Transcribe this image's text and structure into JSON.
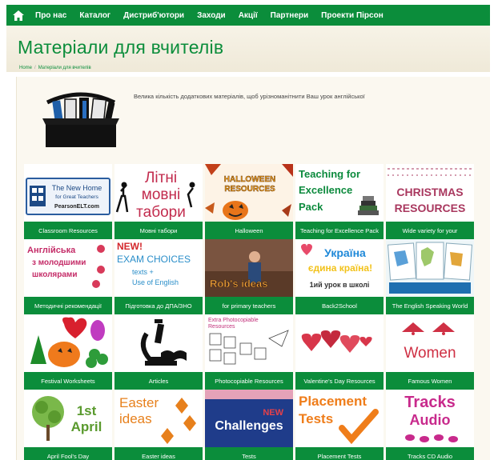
{
  "nav": {
    "home_icon": "home-icon",
    "items": [
      "Про нас",
      "Каталог",
      "Дистриб'ютори",
      "Заходи",
      "Акції",
      "Партнери",
      "Проекти Пірсон"
    ]
  },
  "header": {
    "title": "Матеріали для вчителів",
    "breadcrumb": [
      "Home",
      "Матеріали для вчителів"
    ]
  },
  "intro": {
    "icon": "toolbox-icon",
    "text": "Велика кількість додаткових матеріалів, щоб урізноманітнити Ваш урок англійської"
  },
  "colors": {
    "primary_green": "#0b8d3b",
    "header_bg": "#f3efe2"
  },
  "tiles": [
    {
      "caption": "Classroom Resources",
      "image_text": [
        "The New Home",
        "for Great Teachers",
        "PearsonELT.com"
      ]
    },
    {
      "caption": "Мовні табори",
      "image_text": [
        "Літні",
        "мовні",
        "табори"
      ]
    },
    {
      "caption": "Halloween",
      "image_text": [
        "HALLOWEEN",
        "RESOURCES"
      ]
    },
    {
      "caption": "Teaching for Excellence Pack",
      "image_text": [
        "Teaching for",
        "Excellence",
        "Pack"
      ]
    },
    {
      "caption": "Wide variety for your",
      "image_text": [
        "CHRISTMAS",
        "RESOURCES"
      ]
    },
    {
      "caption": "Методичні рекомендації",
      "image_text": [
        "Англійська",
        "з молодшими",
        "школярами"
      ]
    },
    {
      "caption": "Підготовка до ДПА/ЗНО",
      "image_text": [
        "NEW!",
        "EXAM CHOICES",
        "texts +",
        "Use of English"
      ]
    },
    {
      "caption": "for primary teachers",
      "image_text": [
        "Rob's ideas"
      ]
    },
    {
      "caption": "Back2School",
      "image_text": [
        "Україна",
        "єдина країна!",
        "1ий урок в школі"
      ]
    },
    {
      "caption": "The English Speaking World",
      "image_text": []
    },
    {
      "caption": "Festival Worksheets",
      "image_text": []
    },
    {
      "caption": "Articles",
      "image_text": []
    },
    {
      "caption": "Photocopiable Resources",
      "image_text": [
        "Extra Photocopiable",
        "Resources"
      ]
    },
    {
      "caption": "Valentine's Day Resources",
      "image_text": []
    },
    {
      "caption": "Famous Women",
      "image_text": [
        "Women"
      ]
    },
    {
      "caption": "April Fool's Day",
      "image_text": [
        "1st",
        "April"
      ]
    },
    {
      "caption": "Easter ideas",
      "image_text": [
        "Easter",
        "ideas"
      ]
    },
    {
      "caption": "Tests",
      "image_text": [
        "NEW",
        "Challenges"
      ]
    },
    {
      "caption": "Placement Tests",
      "image_text": [
        "Placement",
        "Tests"
      ]
    },
    {
      "caption": "Tracks CD Audio",
      "image_text": [
        "Tracks",
        "Audio"
      ]
    }
  ]
}
